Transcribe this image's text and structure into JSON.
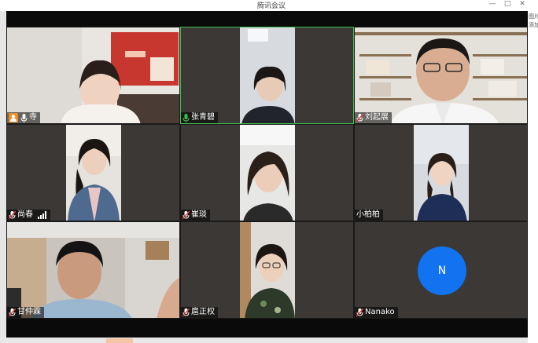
{
  "window": {
    "title": "腾讯会议",
    "minimize": "—",
    "maximize": "□",
    "close": "✕"
  },
  "side_panel": {
    "line1": "图片",
    "line2": "添加"
  },
  "participants": [
    {
      "name": "寺",
      "host": true,
      "mic": "on",
      "active": false
    },
    {
      "name": "张青碧",
      "host": false,
      "mic": "speaking",
      "active": true
    },
    {
      "name": "刘起展",
      "host": false,
      "mic": "muted",
      "active": false
    },
    {
      "name": "尚春",
      "host": false,
      "mic": "muted",
      "active": false,
      "signal": true
    },
    {
      "name": "崔琰",
      "host": false,
      "mic": "muted",
      "active": false
    },
    {
      "name": "小柏柏",
      "host": false,
      "mic": "none",
      "active": false
    },
    {
      "name": "甘仲霖",
      "host": false,
      "mic": "muted",
      "active": false
    },
    {
      "name": "扈正权",
      "host": false,
      "mic": "muted",
      "active": false
    },
    {
      "name": "Nanako",
      "host": false,
      "mic": "muted",
      "active": false,
      "avatar_letter": "N"
    }
  ],
  "colors": {
    "active_border": "#3fbf4f",
    "avatar_bg": "#1173f0",
    "host_badge": "#f08a24",
    "speaking_mic": "#3fbf4f",
    "muted_mic": "#e23b3b"
  }
}
